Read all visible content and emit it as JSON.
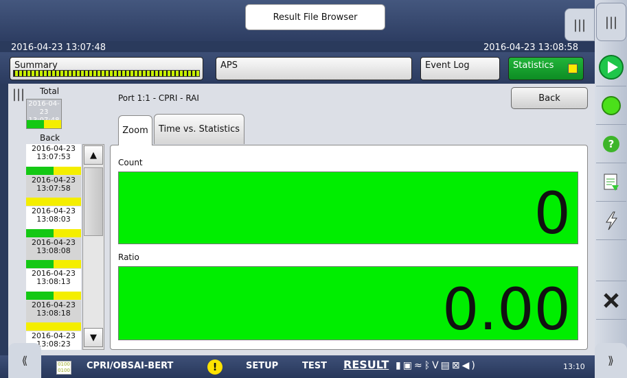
{
  "window": {
    "title": "Result File Browser"
  },
  "header": {
    "start_time": "2016-04-23 13:07:48",
    "end_time": "2016-04-23 13:08:58"
  },
  "tabs": {
    "summary": "Summary",
    "aps": "APS",
    "event_log": "Event Log",
    "statistics": "Statistics"
  },
  "history": {
    "total_label": "Total",
    "total_card": {
      "date": "2016-04-23",
      "time": "13:07:48"
    },
    "back_label": "Back",
    "items": [
      {
        "date": "2016-04-23",
        "time": "13:07:53"
      },
      {
        "date": "2016-04-23",
        "time": "13:07:58"
      },
      {
        "date": "2016-04-23",
        "time": "13:08:03"
      },
      {
        "date": "2016-04-23",
        "time": "13:08:08"
      },
      {
        "date": "2016-04-23",
        "time": "13:08:13"
      },
      {
        "date": "2016-04-23",
        "time": "13:08:18"
      },
      {
        "date": "2016-04-23",
        "time": "13:08:23"
      }
    ]
  },
  "main": {
    "port_label": "Port 1:1 - CPRI - RAI",
    "back_button": "Back",
    "tab_zoom": "Zoom",
    "tab_time": "Time vs. Statistics",
    "count_label": "Count",
    "count_value": "0",
    "ratio_label": "Ratio",
    "ratio_value": "0.00"
  },
  "bottom": {
    "app_name": "CPRI/OBSAI-BERT",
    "setup": "SETUP",
    "test": "TEST",
    "result": "RESULT",
    "clock": "13:10"
  },
  "colors": {
    "green": "#00ee00",
    "accent": "#2d3d62",
    "statistics_btn": "#16a02c",
    "indicator_yellow": "#ffe900"
  }
}
